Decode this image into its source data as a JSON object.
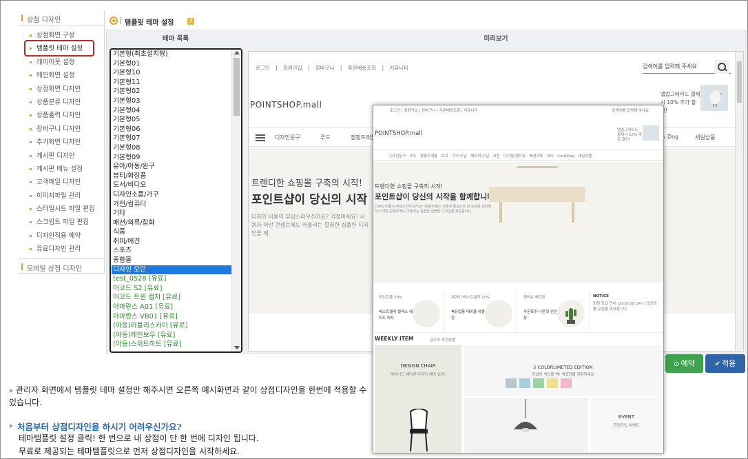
{
  "sidebar": {
    "section_title": "상점 디자인",
    "items": [
      {
        "label": "상점화면 구성"
      },
      {
        "label": "템플릿 테마 설정"
      },
      {
        "label": "레이아웃 설정"
      },
      {
        "label": "메인화면 설정"
      },
      {
        "label": "상점화면 디자인"
      },
      {
        "label": "상품분류 디자인"
      },
      {
        "label": "상품출력 디자인"
      },
      {
        "label": "장바구니 디자인"
      },
      {
        "label": "추가화면 디자인"
      },
      {
        "label": "게시판 디자인"
      },
      {
        "label": "게시판 메뉴 설정"
      },
      {
        "label": "고객메일 디자인"
      },
      {
        "label": "이미지파일 관리"
      },
      {
        "label": "스타일시트 파일 편집"
      },
      {
        "label": "스크립트 파일 편집"
      },
      {
        "label": "디자인적용 예약"
      },
      {
        "label": "유료디자인 관리"
      }
    ],
    "mobile_section_title": "모바일 상점 디자인"
  },
  "header": {
    "title": "템플릿 테마 설정",
    "help_icon": "?"
  },
  "columns": {
    "left": "테마 목록",
    "right": "미리보기"
  },
  "theme_list": [
    "기본형(최초설치형)",
    "기본형01",
    "기본형10",
    "기본형11",
    "기본형02",
    "기본형03",
    "기본형04",
    "기본형05",
    "기본형06",
    "기본형07",
    "기본형08",
    "기본형09",
    "유아/아동/완구",
    "뷰티/화장품",
    "도서/비디오",
    "디자인소품/가구",
    "가전/컴퓨터",
    "기타",
    "패션/의류/잡화",
    "식품",
    "취미/애견",
    "스포츠",
    "종합몰",
    "디자인 모던",
    "test_0528 [유료]",
    "어코드 S2 [유료]",
    "어코드 트윈 컬처 [유료]",
    "아마란스 A01 [유료]",
    "아마란스 VB01 [유료]",
    "(아동)러블리스카이 [유료]",
    "(아동)레인보우 [유료]",
    "(아동)스위트하트 [유료]"
  ],
  "theme_list_paid_from": 24,
  "theme_list_selected": 23,
  "preview": {
    "top_links": "로그인 | 회원가입 | 장바구니 | 주문배송조회 | 커뮤니티",
    "search_placeholder": "검색어를 입력해 주세요",
    "logo": "POINTSHOP.mall",
    "banner_text": "앱업그레이드 결제시 10% 추가 할인!",
    "menu": [
      "디자인문구",
      "푸드",
      "캠핑트래블",
      "t& Dog",
      "세일상품"
    ],
    "hero_line1": "트렌디한 쇼핑몰 구축의 시작!",
    "hero_line2": "포인트샵이 당신의 시작",
    "hero_line3": "디자인 비용이 부담스러우신가요? 걱정마세요! 사용자 어떤 콘셉트에도 어울리는 깔끔한 심플한 디자인을 제"
  },
  "overlay": {
    "top_links": "로그인 | 회원가입 | 장바구니 | 주문배송조회 | 커뮤니티",
    "search_placeholder": "검색어를 입력해 주세요",
    "logo": "POINTSHOP.mall",
    "banner_text": "앱업그레이드 결제시 10% 추가 할인!",
    "menu": "디자인문구   푸드   캠핑트래블   토이   가구/수납   패브릭/수납   키친   디지털/핸드폰   패션의류   뷰티   Cat&Dog   세일상품",
    "hero_line1": "트렌디한 쇼핑몰 구축의 시작!",
    "hero_line2": "포인트샵이 당신의 시작을 함께합니다!",
    "hero_line3": "디자인 비용이 부담스러우신가요? 걱정마세요! 사용자 중심으로 한 손쉬운 인터페이스 어떤 콘셉트에도 어울리는 깔끔한 심플한 디자인을 제공합니다.",
    "cards": [
      {
        "tag": "포인트몰 20%",
        "title": "베스트셀러 얼레스 에이드 의자"
      },
      {
        "tag": "자연이 베스트셀러 15%",
        "title": "북유럽풍 테이블 유용한"
      },
      {
        "tag": "해외& 베트엔",
        "title": "주문폭주 나만의 선인장"
      },
      {
        "tag": "NOTICE",
        "title": "회원 등급 안내 (2016.08.14~) 포인트몰 오픈을 축하합니다"
      }
    ],
    "weekly": "WEEKLY ITEM",
    "weekly_sub": "금주의 추천상품",
    "block1_title": "DESIGN CHAIR",
    "block1_sub": "라이너드 에디션 디자인 체어 오픈!",
    "block2_title": "5 COLORLIMETED EDITION",
    "block2_sub": "망설이 색상을 택! 색표현을 경험하세요",
    "block4_title": "EVENT",
    "block4_sub": "회원가입 이벤트"
  },
  "buttons": {
    "reserve": "예약",
    "apply": "적용"
  },
  "notes": {
    "line1": "관리자 화면에서 템플릿 테마 설정만 해주시면 오른쪽 예시화면과 같이 상점디자인을 한번에 적용할 수 있습니다.",
    "title2": "처음부터 상점디자인을 하시기 어려우신가요?",
    "line2": "테마템플릿 설정 클릭! 한 번으로 내 상점이 단 한 번에 디자인 됩니다.",
    "line3": "무료로 제공되는 테마템플릿으로 먼저 상점디자인을 시작하세요."
  },
  "colors": {
    "accent": "#f19a1e",
    "highlight_border": "#c0292b",
    "selected_item": "#1e7ae0",
    "paid_theme_text": "#2b8a2b",
    "reserve_button": "#3fa34d",
    "apply_button": "#2e64a8",
    "note_title": "#2a6aaf"
  }
}
